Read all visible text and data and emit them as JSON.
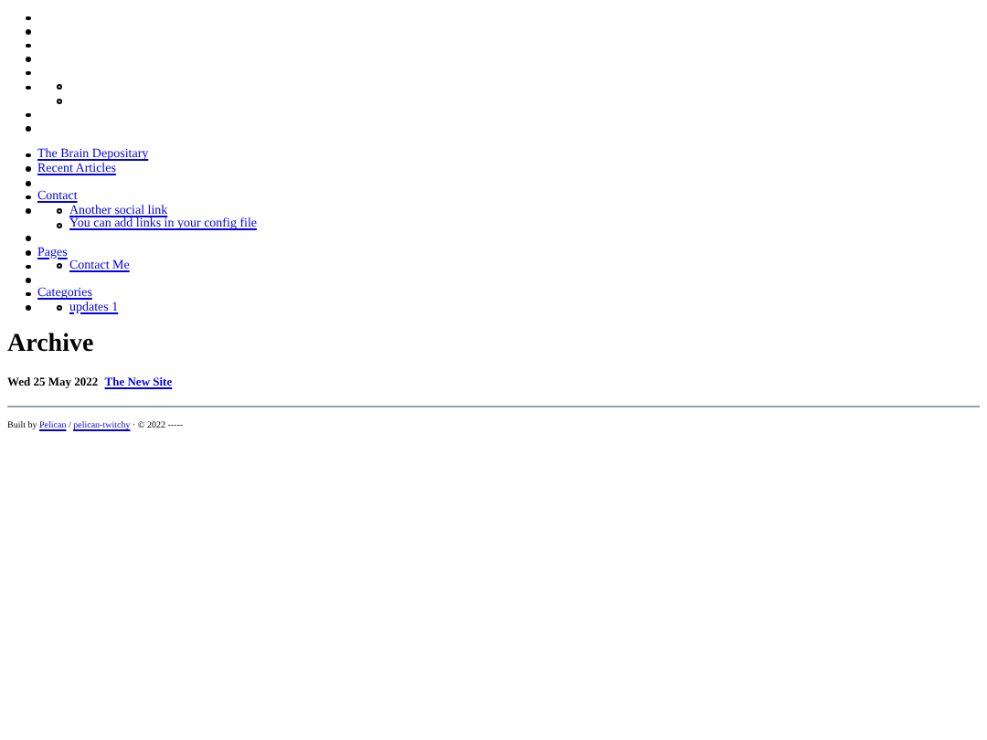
{
  "top_list": [
    {
      "kind": "empty"
    },
    {
      "kind": "empty"
    },
    {
      "kind": "empty"
    },
    {
      "kind": "empty"
    },
    {
      "kind": "empty"
    },
    {
      "kind": "empty",
      "children": [
        {
          "kind": "empty"
        },
        {
          "kind": "empty"
        }
      ]
    },
    {
      "kind": "empty"
    },
    {
      "kind": "empty"
    }
  ],
  "nav_list": [
    {
      "kind": "link",
      "label": "The Brain Depositary"
    },
    {
      "kind": "link",
      "label": "Recent Articles"
    },
    {
      "kind": "empty"
    },
    {
      "kind": "link",
      "label": "Contact"
    },
    {
      "kind": "empty",
      "children": [
        {
          "kind": "link",
          "label": "Another social link"
        },
        {
          "kind": "link",
          "label": "You can add links in your config file"
        }
      ]
    },
    {
      "kind": "empty"
    },
    {
      "kind": "link",
      "label": "Pages"
    },
    {
      "kind": "empty",
      "children": [
        {
          "kind": "link",
          "label": "Contact Me"
        }
      ]
    },
    {
      "kind": "empty"
    },
    {
      "kind": "link",
      "label": "Categories"
    },
    {
      "kind": "empty",
      "children": [
        {
          "kind": "link",
          "label": "updates 1"
        }
      ]
    }
  ],
  "heading": "Archive",
  "entries": [
    {
      "date": "Wed 25 May 2022",
      "title": "The New Site"
    }
  ],
  "footer": {
    "prefix": "Built by",
    "link_1": "Pelican",
    "separator": "/",
    "link_2": "pelican-twitchy",
    "suffix": "· © 2022 -----"
  }
}
